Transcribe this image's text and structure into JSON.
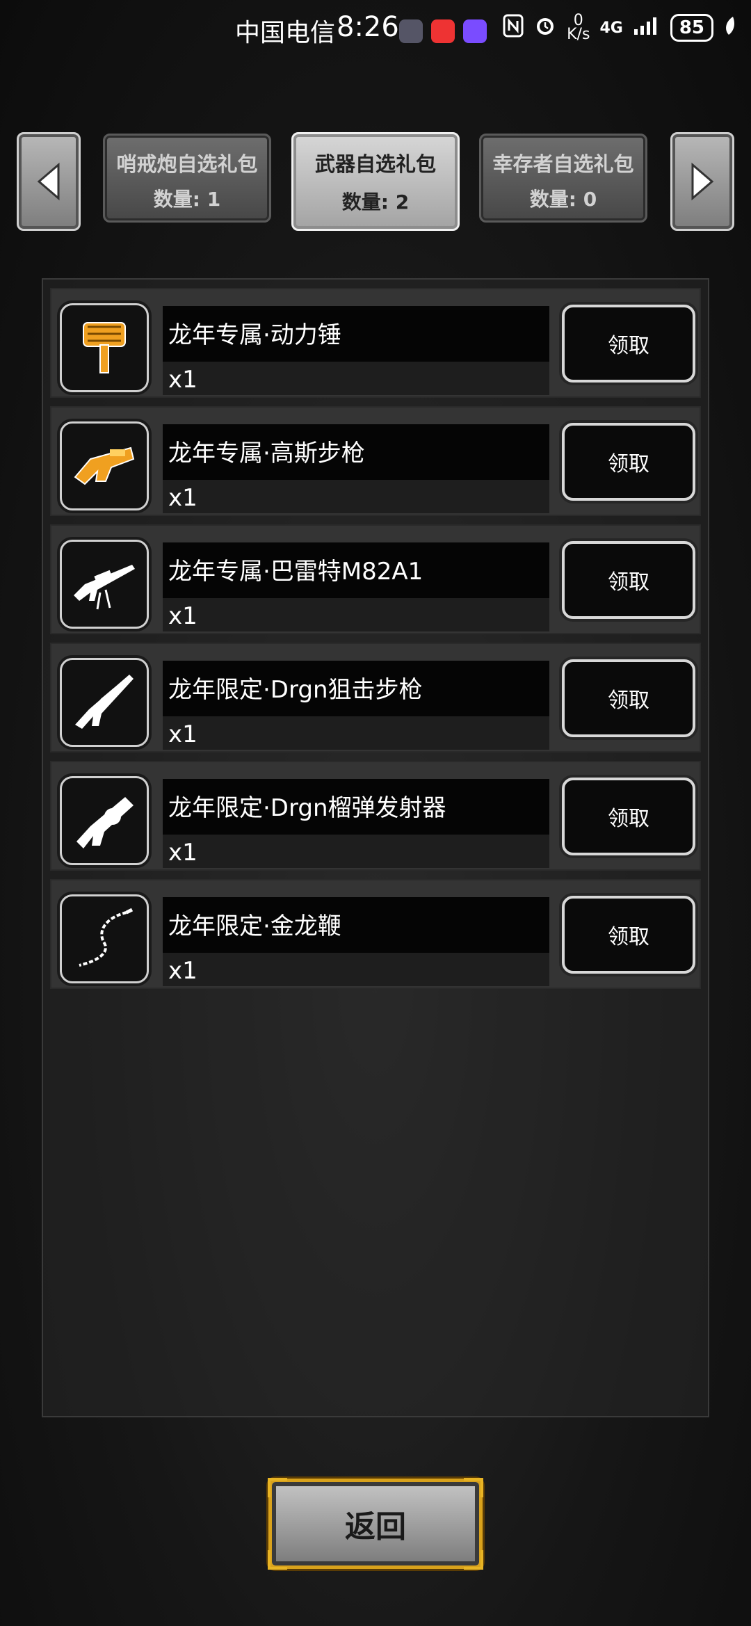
{
  "status_bar": {
    "carrier": "中国电信",
    "time": "8:26",
    "net_speed_top": "0",
    "net_speed_bottom": "K/s",
    "network": "4G",
    "battery": "85"
  },
  "tabs": {
    "prev_icon": "left-arrow-icon",
    "next_icon": "right-arrow-icon",
    "items": [
      {
        "name": "哨戒炮自选礼包",
        "count": "数量: 1"
      },
      {
        "name": "武器自选礼包",
        "count": "数量: 2"
      },
      {
        "name": "幸存者自选礼包",
        "count": "数量: 0"
      }
    ],
    "active_index": 1
  },
  "items": [
    {
      "name": "龙年专属·动力锤",
      "qty": "x1",
      "claim": "领取",
      "icon": "power-hammer-icon"
    },
    {
      "name": "龙年专属·高斯步枪",
      "qty": "x1",
      "claim": "领取",
      "icon": "gauss-rifle-icon"
    },
    {
      "name": "龙年专属·巴雷特M82A1",
      "qty": "x1",
      "claim": "领取",
      "icon": "barrett-rifle-icon"
    },
    {
      "name": "龙年限定·Drgn狙击步枪",
      "qty": "x1",
      "claim": "领取",
      "icon": "sniper-rifle-icon"
    },
    {
      "name": "龙年限定·Drgn榴弹发射器",
      "qty": "x1",
      "claim": "领取",
      "icon": "grenade-launcher-icon"
    },
    {
      "name": "龙年限定·金龙鞭",
      "qty": "x1",
      "claim": "领取",
      "icon": "dragon-whip-icon"
    }
  ],
  "back_button": {
    "label": "返回"
  },
  "colors": {
    "gold": "#e8b424",
    "orange_item": "#f0a020"
  }
}
